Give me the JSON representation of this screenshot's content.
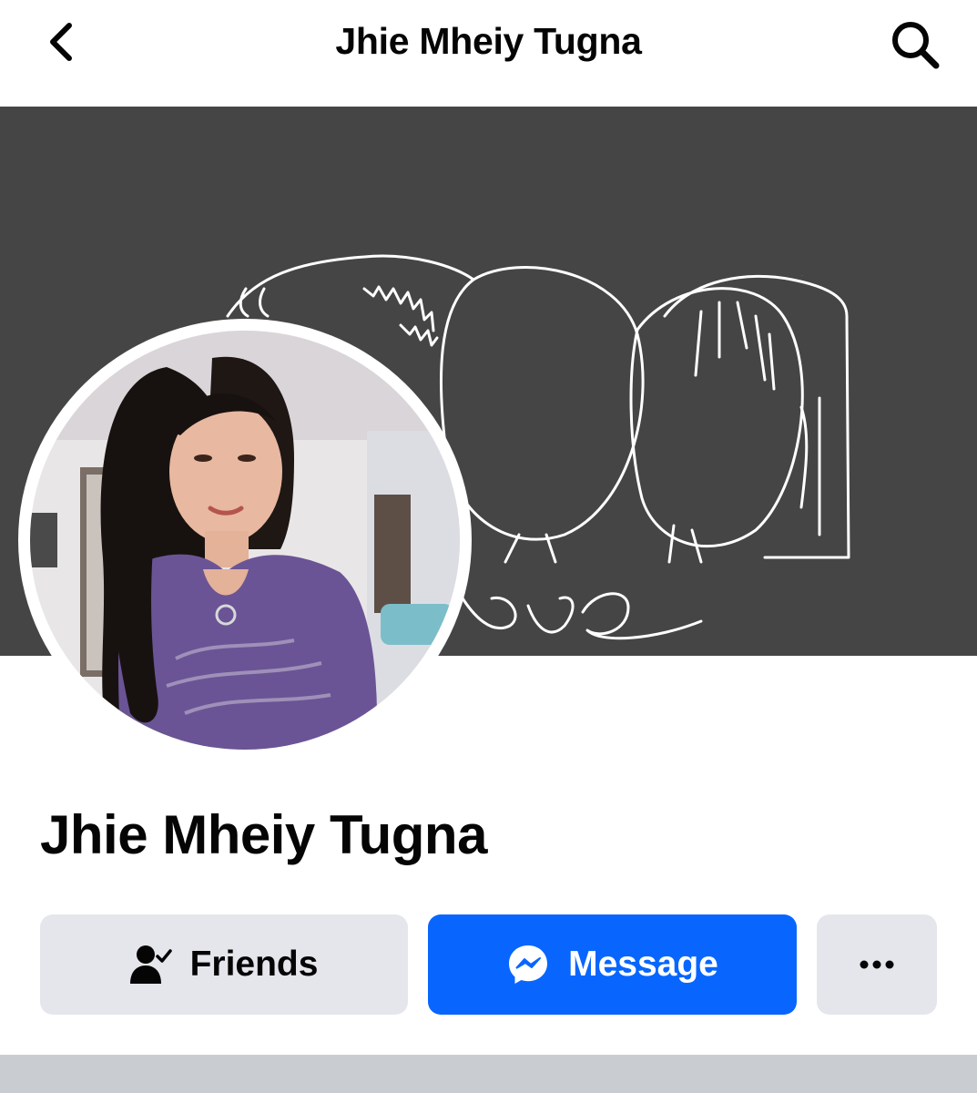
{
  "header": {
    "title": "Jhie Mheiy Tugna",
    "back_icon": "chevron-left-icon",
    "search_icon": "search-icon"
  },
  "cover": {
    "text": "Love",
    "background_color": "#454545"
  },
  "profile": {
    "name": "Jhie Mheiy Tugna"
  },
  "actions": {
    "friends_label": "Friends",
    "friends_icon": "friend-check-icon",
    "message_label": "Message",
    "message_icon": "messenger-icon",
    "more_icon": "more-dots-icon"
  },
  "colors": {
    "primary": "#0866ff",
    "secondary_button": "#e4e6eb",
    "divider": "#c9ccd1"
  }
}
